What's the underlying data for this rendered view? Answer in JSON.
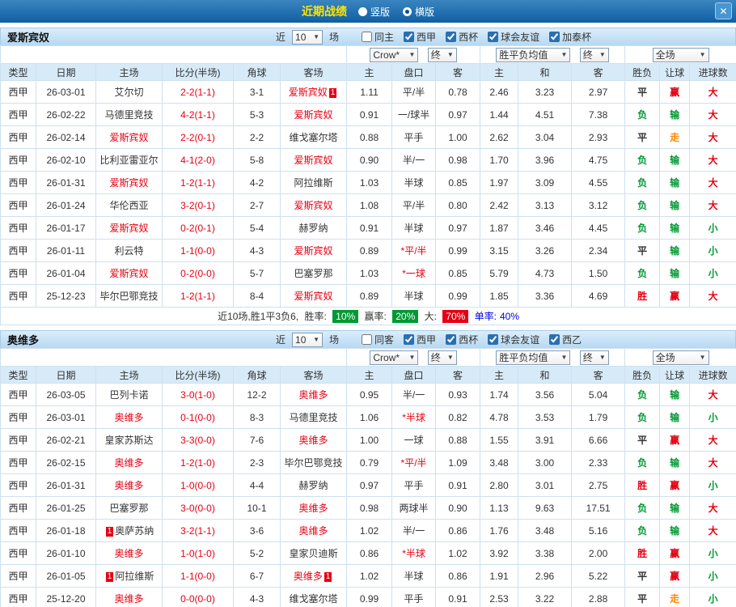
{
  "titlebar": {
    "title": "近期战绩",
    "layout_options": [
      {
        "label": "竖版",
        "selected": false
      },
      {
        "label": "横版",
        "selected": true
      }
    ],
    "close_icon": "✕"
  },
  "filter_bar": {
    "near_label": "近",
    "near_value": "10",
    "matches_label": "场"
  },
  "dropdowns": {
    "bookmaker": "Crow*",
    "final_a": "终",
    "europe_avg": "胜平负均值",
    "final_b": "终",
    "scope": "全场"
  },
  "table_headers": {
    "left": [
      "类型",
      "日期",
      "主场",
      "比分(半场)",
      "角球",
      "客场"
    ],
    "handicap_group": [
      "主",
      "盘口",
      "客"
    ],
    "europe_group": [
      "主",
      "和",
      "客"
    ],
    "result_group": [
      "胜负",
      "让球",
      "进球数"
    ]
  },
  "colors": {
    "text": "#333333",
    "focus_team": "#e60012",
    "score": "#e60012",
    "star_handicap": "#e60012",
    "result": {
      "胜": "#e60012",
      "平": "#333333",
      "负": "#009933"
    },
    "handicap_result": {
      "赢": "#e60012",
      "输": "#009933",
      "走": "#ff8800"
    },
    "goals": {
      "大": "#e60012",
      "小": "#009933"
    },
    "rate_green": "#009933",
    "rate_red": "#e60012",
    "odd_rate_blue": "#0000e6"
  },
  "sections": [
    {
      "team": "爱斯宾奴",
      "filters": {
        "checkboxes": [
          {
            "label": "同主",
            "checked": false
          },
          {
            "label": "西甲",
            "checked": true
          },
          {
            "label": "西杯",
            "checked": true
          },
          {
            "label": "球会友谊",
            "checked": true
          },
          {
            "label": "加泰杯",
            "checked": true
          }
        ]
      },
      "rows": [
        {
          "league": "西甲",
          "date": "26-03-01",
          "home": {
            "name": "艾尔切",
            "focus": false
          },
          "score": "2-2(1-1)",
          "corners": "3-1",
          "away": {
            "name": "爱斯宾奴",
            "focus": true,
            "red_after": "1"
          },
          "ah": {
            "home": "1.11",
            "line": "平/半",
            "away": "0.78"
          },
          "eu": {
            "home": "2.46",
            "draw": "3.23",
            "away": "2.97"
          },
          "result": "平",
          "handicap_result": "赢",
          "goals": "大"
        },
        {
          "league": "西甲",
          "date": "26-02-22",
          "home": {
            "name": "马德里竞技",
            "focus": false
          },
          "score": "4-2(1-1)",
          "corners": "5-3",
          "away": {
            "name": "爱斯宾奴",
            "focus": true
          },
          "ah": {
            "home": "0.91",
            "line": "一/球半",
            "away": "0.97"
          },
          "eu": {
            "home": "1.44",
            "draw": "4.51",
            "away": "7.38"
          },
          "result": "负",
          "handicap_result": "输",
          "goals": "大"
        },
        {
          "league": "西甲",
          "date": "26-02-14",
          "home": {
            "name": "爱斯宾奴",
            "focus": true
          },
          "score": "2-2(0-1)",
          "corners": "2-2",
          "away": {
            "name": "维戈塞尔塔",
            "focus": false
          },
          "ah": {
            "home": "0.88",
            "line": "平手",
            "away": "1.00"
          },
          "eu": {
            "home": "2.62",
            "draw": "3.04",
            "away": "2.93"
          },
          "result": "平",
          "handicap_result": "走",
          "goals": "大"
        },
        {
          "league": "西甲",
          "date": "26-02-10",
          "home": {
            "name": "比利亚雷亚尔",
            "focus": false
          },
          "score": "4-1(2-0)",
          "corners": "5-8",
          "away": {
            "name": "爱斯宾奴",
            "focus": true
          },
          "ah": {
            "home": "0.90",
            "line": "半/一",
            "away": "0.98"
          },
          "eu": {
            "home": "1.70",
            "draw": "3.96",
            "away": "4.75"
          },
          "result": "负",
          "handicap_result": "输",
          "goals": "大"
        },
        {
          "league": "西甲",
          "date": "26-01-31",
          "home": {
            "name": "爱斯宾奴",
            "focus": true
          },
          "score": "1-2(1-1)",
          "corners": "4-2",
          "away": {
            "name": "阿拉维斯",
            "focus": false
          },
          "ah": {
            "home": "1.03",
            "line": "半球",
            "away": "0.85"
          },
          "eu": {
            "home": "1.97",
            "draw": "3.09",
            "away": "4.55"
          },
          "result": "负",
          "handicap_result": "输",
          "goals": "大"
        },
        {
          "league": "西甲",
          "date": "26-01-24",
          "home": {
            "name": "华伦西亚",
            "focus": false
          },
          "score": "3-2(0-1)",
          "corners": "2-7",
          "away": {
            "name": "爱斯宾奴",
            "focus": true
          },
          "ah": {
            "home": "1.08",
            "line": "平/半",
            "away": "0.80"
          },
          "eu": {
            "home": "2.42",
            "draw": "3.13",
            "away": "3.12"
          },
          "result": "负",
          "handicap_result": "输",
          "goals": "大"
        },
        {
          "league": "西甲",
          "date": "26-01-17",
          "home": {
            "name": "爱斯宾奴",
            "focus": true
          },
          "score": "0-2(0-1)",
          "corners": "5-4",
          "away": {
            "name": "赫罗纳",
            "focus": false
          },
          "ah": {
            "home": "0.91",
            "line": "半球",
            "away": "0.97"
          },
          "eu": {
            "home": "1.87",
            "draw": "3.46",
            "away": "4.45"
          },
          "result": "负",
          "handicap_result": "输",
          "goals": "小"
        },
        {
          "league": "西甲",
          "date": "26-01-11",
          "home": {
            "name": "利云特",
            "focus": false
          },
          "score": "1-1(0-0)",
          "corners": "4-3",
          "away": {
            "name": "爱斯宾奴",
            "focus": true
          },
          "ah": {
            "home": "0.89",
            "line": "*平/半",
            "away": "0.99"
          },
          "eu": {
            "home": "3.15",
            "draw": "3.26",
            "away": "2.34"
          },
          "result": "平",
          "handicap_result": "输",
          "goals": "小"
        },
        {
          "league": "西甲",
          "date": "26-01-04",
          "home": {
            "name": "爱斯宾奴",
            "focus": true
          },
          "score": "0-2(0-0)",
          "corners": "5-7",
          "away": {
            "name": "巴塞罗那",
            "focus": false
          },
          "ah": {
            "home": "1.03",
            "line": "*一球",
            "away": "0.85"
          },
          "eu": {
            "home": "5.79",
            "draw": "4.73",
            "away": "1.50"
          },
          "result": "负",
          "handicap_result": "输",
          "goals": "小"
        },
        {
          "league": "西甲",
          "date": "25-12-23",
          "home": {
            "name": "毕尔巴鄂竞技",
            "focus": false
          },
          "score": "1-2(1-1)",
          "corners": "8-4",
          "away": {
            "name": "爱斯宾奴",
            "focus": true
          },
          "ah": {
            "home": "0.89",
            "line": "半球",
            "away": "0.99"
          },
          "eu": {
            "home": "1.85",
            "draw": "3.36",
            "away": "4.69"
          },
          "result": "胜",
          "handicap_result": "赢",
          "goals": "大"
        }
      ],
      "summary": {
        "prefix": "近10场,胜1平3负6,",
        "win_rate_label": "胜率:",
        "win_rate": "10%",
        "handicap_rate_label": "赢率:",
        "handicap_rate": "20%",
        "big_rate_label": "大:",
        "big_rate": "70%",
        "odd_rate_label": "单率:",
        "odd_rate": "40%"
      }
    },
    {
      "team": "奥维多",
      "filters": {
        "checkboxes": [
          {
            "label": "同客",
            "checked": false
          },
          {
            "label": "西甲",
            "checked": true
          },
          {
            "label": "西杯",
            "checked": true
          },
          {
            "label": "球会友谊",
            "checked": true
          },
          {
            "label": "西乙",
            "checked": true
          }
        ]
      },
      "rows": [
        {
          "league": "西甲",
          "date": "26-03-05",
          "home": {
            "name": "巴列卡诺",
            "focus": false
          },
          "score": "3-0(1-0)",
          "corners": "12-2",
          "away": {
            "name": "奥维多",
            "focus": true
          },
          "ah": {
            "home": "0.95",
            "line": "半/一",
            "away": "0.93"
          },
          "eu": {
            "home": "1.74",
            "draw": "3.56",
            "away": "5.04"
          },
          "result": "负",
          "handicap_result": "输",
          "goals": "大"
        },
        {
          "league": "西甲",
          "date": "26-03-01",
          "home": {
            "name": "奥维多",
            "focus": true
          },
          "score": "0-1(0-0)",
          "corners": "8-3",
          "away": {
            "name": "马德里竞技",
            "focus": false
          },
          "ah": {
            "home": "1.06",
            "line": "*半球",
            "away": "0.82"
          },
          "eu": {
            "home": "4.78",
            "draw": "3.53",
            "away": "1.79"
          },
          "result": "负",
          "handicap_result": "输",
          "goals": "小"
        },
        {
          "league": "西甲",
          "date": "26-02-21",
          "home": {
            "name": "皇家苏斯达",
            "focus": false
          },
          "score": "3-3(0-0)",
          "corners": "7-6",
          "away": {
            "name": "奥维多",
            "focus": true
          },
          "ah": {
            "home": "1.00",
            "line": "一球",
            "away": "0.88"
          },
          "eu": {
            "home": "1.55",
            "draw": "3.91",
            "away": "6.66"
          },
          "result": "平",
          "handicap_result": "赢",
          "goals": "大"
        },
        {
          "league": "西甲",
          "date": "26-02-15",
          "home": {
            "name": "奥维多",
            "focus": true
          },
          "score": "1-2(1-0)",
          "corners": "2-3",
          "away": {
            "name": "毕尔巴鄂竞技",
            "focus": false
          },
          "ah": {
            "home": "0.79",
            "line": "*平/半",
            "away": "1.09"
          },
          "eu": {
            "home": "3.48",
            "draw": "3.00",
            "away": "2.33"
          },
          "result": "负",
          "handicap_result": "输",
          "goals": "大"
        },
        {
          "league": "西甲",
          "date": "26-01-31",
          "home": {
            "name": "奥维多",
            "focus": true
          },
          "score": "1-0(0-0)",
          "corners": "4-4",
          "away": {
            "name": "赫罗纳",
            "focus": false
          },
          "ah": {
            "home": "0.97",
            "line": "平手",
            "away": "0.91"
          },
          "eu": {
            "home": "2.80",
            "draw": "3.01",
            "away": "2.75"
          },
          "result": "胜",
          "handicap_result": "赢",
          "goals": "小"
        },
        {
          "league": "西甲",
          "date": "26-01-25",
          "home": {
            "name": "巴塞罗那",
            "focus": false
          },
          "score": "3-0(0-0)",
          "corners": "10-1",
          "away": {
            "name": "奥维多",
            "focus": true
          },
          "ah": {
            "home": "0.98",
            "line": "两球半",
            "away": "0.90"
          },
          "eu": {
            "home": "1.13",
            "draw": "9.63",
            "away": "17.51"
          },
          "result": "负",
          "handicap_result": "输",
          "goals": "大"
        },
        {
          "league": "西甲",
          "date": "26-01-18",
          "home": {
            "name": "奥萨苏纳",
            "focus": false,
            "red_before": "1"
          },
          "score": "3-2(1-1)",
          "corners": "3-6",
          "away": {
            "name": "奥维多",
            "focus": true
          },
          "ah": {
            "home": "1.02",
            "line": "半/一",
            "away": "0.86"
          },
          "eu": {
            "home": "1.76",
            "draw": "3.48",
            "away": "5.16"
          },
          "result": "负",
          "handicap_result": "输",
          "goals": "大"
        },
        {
          "league": "西甲",
          "date": "26-01-10",
          "home": {
            "name": "奥维多",
            "focus": true
          },
          "score": "1-0(1-0)",
          "corners": "5-2",
          "away": {
            "name": "皇家贝迪斯",
            "focus": false
          },
          "ah": {
            "home": "0.86",
            "line": "*半球",
            "away": "1.02"
          },
          "eu": {
            "home": "3.92",
            "draw": "3.38",
            "away": "2.00"
          },
          "result": "胜",
          "handicap_result": "赢",
          "goals": "小"
        },
        {
          "league": "西甲",
          "date": "26-01-05",
          "home": {
            "name": "阿拉维斯",
            "focus": false,
            "red_before": "1"
          },
          "score": "1-1(0-0)",
          "corners": "6-7",
          "away": {
            "name": "奥维多",
            "focus": true,
            "red_after": "1"
          },
          "ah": {
            "home": "1.02",
            "line": "半球",
            "away": "0.86"
          },
          "eu": {
            "home": "1.91",
            "draw": "2.96",
            "away": "5.22"
          },
          "result": "平",
          "handicap_result": "赢",
          "goals": "小"
        },
        {
          "league": "西甲",
          "date": "25-12-20",
          "home": {
            "name": "奥维多",
            "focus": true
          },
          "score": "0-0(0-0)",
          "corners": "4-3",
          "away": {
            "name": "维戈塞尔塔",
            "focus": false
          },
          "ah": {
            "home": "0.99",
            "line": "平手",
            "away": "0.91"
          },
          "eu": {
            "home": "2.53",
            "draw": "3.22",
            "away": "2.88"
          },
          "result": "平",
          "handicap_result": "走",
          "goals": "小"
        }
      ]
    }
  ]
}
